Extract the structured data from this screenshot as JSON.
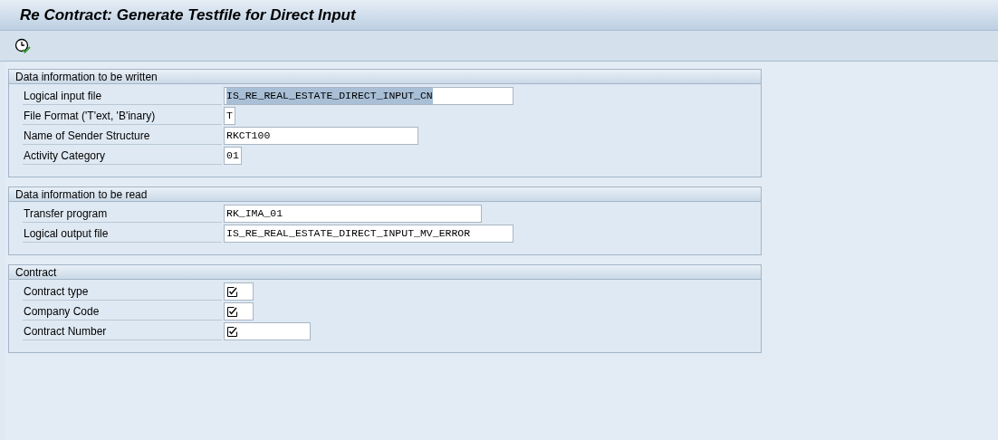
{
  "window": {
    "title": "Re Contract: Generate Testfile for Direct Input"
  },
  "sections": [
    {
      "title": "Data information to be written",
      "fields": [
        {
          "label": "Logical input file",
          "kind": "text",
          "value": "IS_RE_REAL_ESTATE_DIRECT_INPUT_CN",
          "value_selected": true
        },
        {
          "label": "File Format ('T'ext, 'B'inary)",
          "kind": "text",
          "value": "T",
          "value_selected": false
        },
        {
          "label": "Name of Sender Structure",
          "kind": "text",
          "value": "RKCT100",
          "value_selected": false
        },
        {
          "label": "Activity Category",
          "kind": "text",
          "value": "01",
          "value_selected": false
        }
      ]
    },
    {
      "title": "Data information to be read",
      "fields": [
        {
          "label": "Transfer program",
          "kind": "text",
          "value": "RK_IMA_01",
          "value_selected": false
        },
        {
          "label": "Logical output file",
          "kind": "text",
          "value": "IS_RE_REAL_ESTATE_DIRECT_INPUT_MV_ERROR",
          "value_selected": false
        }
      ]
    },
    {
      "title": "Contract",
      "fields": [
        {
          "label": "Contract type",
          "kind": "checkbox",
          "checked": true
        },
        {
          "label": "Company Code",
          "kind": "checkbox",
          "checked": true
        },
        {
          "label": "Contract Number",
          "kind": "checkbox",
          "checked": true
        }
      ]
    }
  ]
}
